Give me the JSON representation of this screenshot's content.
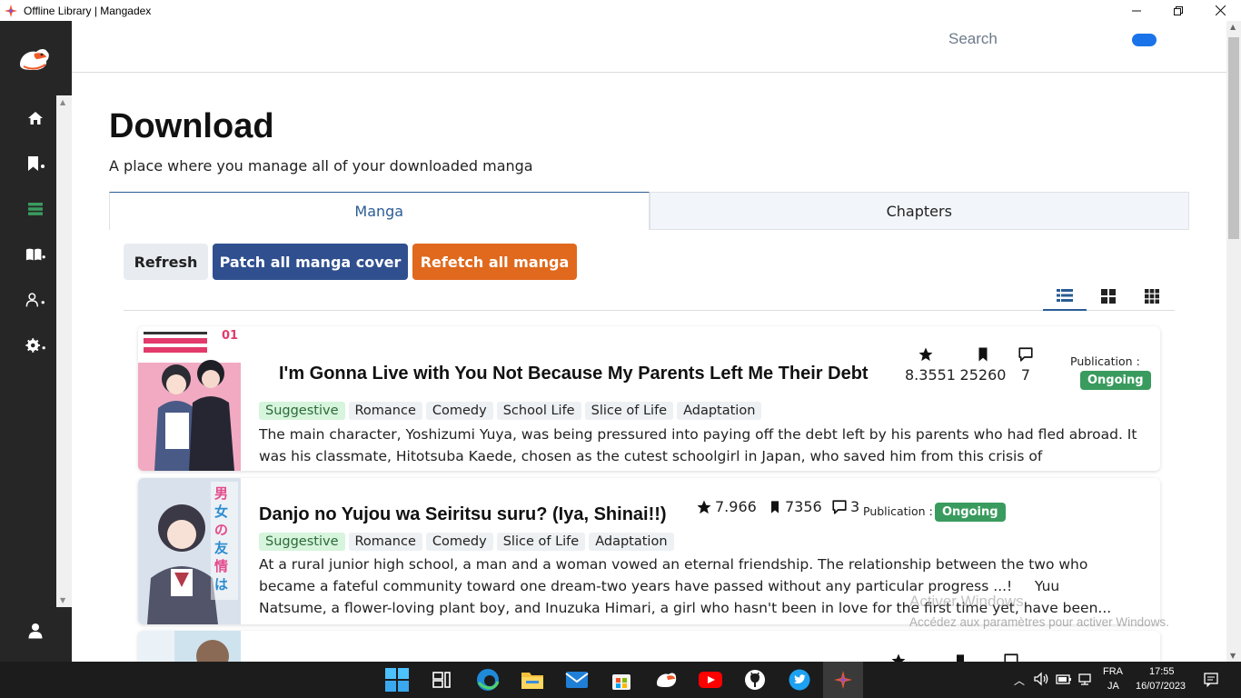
{
  "window": {
    "title": "Offline Library | Mangadex",
    "buttons": [
      "minimize",
      "restore",
      "close"
    ]
  },
  "sidebar": {
    "items": [
      {
        "icon": "home-icon"
      },
      {
        "icon": "bookmark-icon"
      },
      {
        "icon": "download-list-icon",
        "active": true
      },
      {
        "icon": "book-open-icon"
      },
      {
        "icon": "users-icon"
      },
      {
        "icon": "settings-icon"
      },
      {
        "icon": "user-icon"
      }
    ],
    "active_color": "#3a9b5e"
  },
  "header": {
    "search_placeholder": "Search",
    "toggle_color": "#1a73e8"
  },
  "page": {
    "title": "Download",
    "subtitle": "A place where you manage all of your downloaded manga"
  },
  "tabs": [
    {
      "label": "Manga",
      "active": true
    },
    {
      "label": "Chapters",
      "active": false
    }
  ],
  "actions": {
    "refresh": "Refresh",
    "patch": "Patch all manga cover",
    "refetch": "Refetch all manga"
  },
  "mangas": [
    {
      "title": "I'm Gonna Live with You Not Because My Parents Left Me Their Debt",
      "tags": [
        "Suggestive",
        "Romance",
        "Comedy",
        "School Life",
        "Slice of Life",
        "Adaptation"
      ],
      "description": "The main character, Yoshizumi Yuya, was being pressured into paying off the debt left by his parents who had fled abroad. It was his classmate, Hitotsuba Kaede, chosen as the cutest schoolgirl in Japan, who saved him from this crisis of",
      "rating": "8.3551",
      "follows": "25260",
      "comments": "7",
      "publication_label": "Publication :",
      "status": "Ongoing",
      "cover_text": "01"
    },
    {
      "title": "Danjo no Yujou wa Seiritsu suru? (Iya, Shinai!!)",
      "tags": [
        "Suggestive",
        "Romance",
        "Comedy",
        "Slice of Life",
        "Adaptation"
      ],
      "description": "At a rural junior high school, a man and a woman vowed an eternal friendship. The relationship between the two who became a fateful community toward one dream-two years have passed without any particular progress ...!     Yuu Natsume, a flower-loving plant boy, and Inuzuka Himari, a girl who hasn't been in love for the first time yet, have been...",
      "rating": "7.966",
      "follows": "7356",
      "comments": "3",
      "publication_label": "Publication :",
      "status": "Ongoing",
      "cover_text": "男女の友情は成立する"
    }
  ],
  "watermark": {
    "line1": "Activer Windows",
    "line2": "Accédez aux paramètres pour activer Windows."
  },
  "taskbar": {
    "lang_top": "FRA",
    "lang_bottom": "JA",
    "time": "17:55",
    "date": "16/07/2023"
  }
}
